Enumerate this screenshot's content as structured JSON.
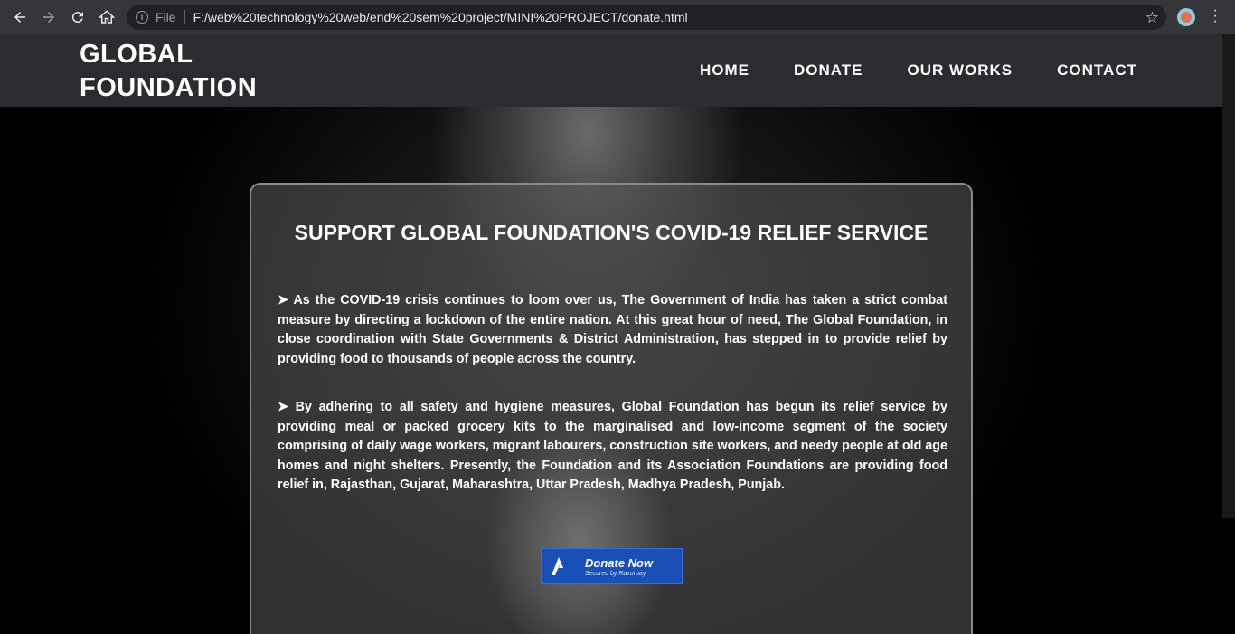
{
  "browser": {
    "file_label": "File",
    "url": "F:/web%20technology%20web/end%20sem%20project/MINI%20PROJECT/donate.html"
  },
  "header": {
    "brand_line1": "GLOBAL",
    "brand_line2": "FOUNDATION",
    "nav": [
      "HOME",
      "DONATE",
      "OUR WORKS",
      "CONTACT"
    ]
  },
  "card": {
    "title": "SUPPORT GLOBAL FOUNDATION'S COVID-19 RELIEF SERVICE",
    "paragraph1": "➤ As the COVID-19 crisis continues to loom over us, The Government of India has taken a strict combat measure by directing a lockdown of the entire nation. At this great hour of need, The Global Foundation, in close coordination with State Governments & District Administration, has stepped in to provide relief by providing food to thousands of people across the country.",
    "paragraph2": "➤ By adhering to all safety and hygiene measures, Global Foundation has begun its relief service by providing meal or packed grocery kits to the marginalised and low-income segment of the society comprising of daily wage workers, migrant labourers, construction site workers, and needy people at old age homes and night shelters. Presently, the Foundation and its Association Foundations are providing food relief in, Rajasthan, Gujarat, Maharashtra, Uttar Pradesh, Madhya Pradesh, Punjab.",
    "donate_label": "Donate Now",
    "donate_sub": "Secured by Razorpay"
  }
}
